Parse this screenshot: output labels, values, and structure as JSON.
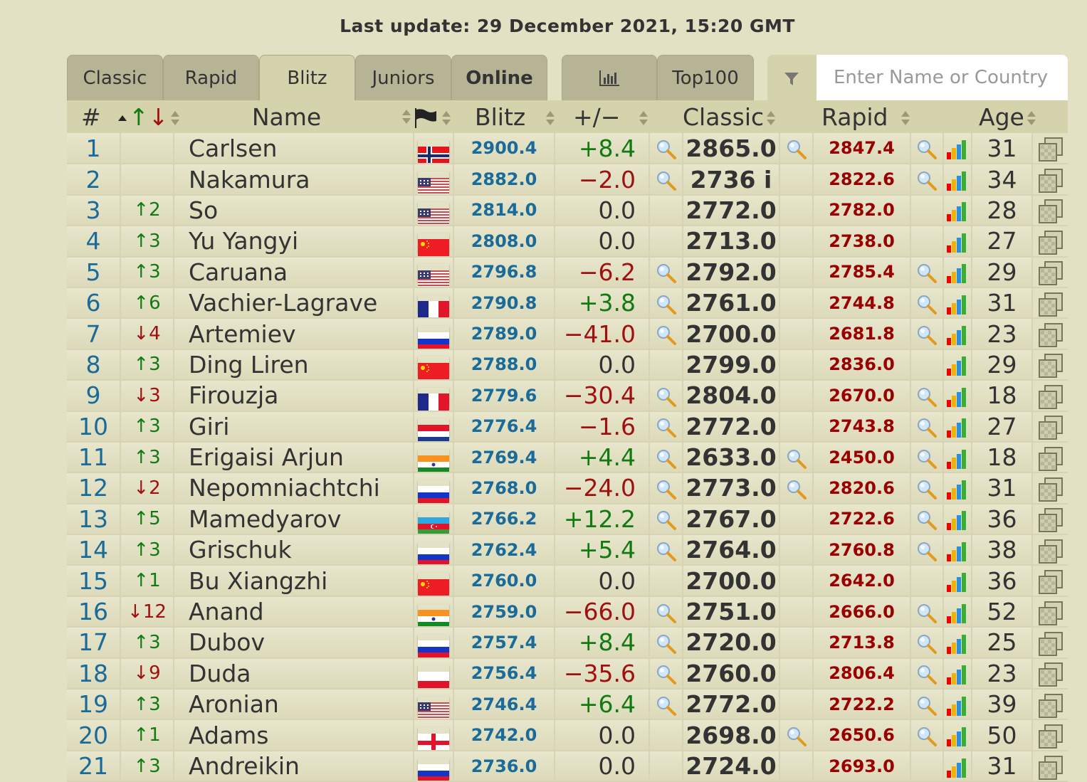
{
  "header": {
    "last_update": "Last update: 29 December 2021, 15:20 GMT"
  },
  "tabs": [
    {
      "label": "Classic",
      "active": false,
      "bold": false
    },
    {
      "label": "Rapid",
      "active": false,
      "bold": false
    },
    {
      "label": "Blitz",
      "active": true,
      "bold": false
    },
    {
      "label": "Juniors",
      "active": false,
      "bold": false
    },
    {
      "label": "Online",
      "active": false,
      "bold": true
    }
  ],
  "extra_tabs": [
    {
      "label": "",
      "icon": "bar-chart-icon"
    },
    {
      "label": "Top100"
    }
  ],
  "search": {
    "placeholder": "Enter Name or Country",
    "value": ""
  },
  "columns": {
    "rank": "#",
    "move": "↑↓",
    "name": "Name",
    "flag": "flag-icon",
    "blitz": "Blitz",
    "diff": "+/−",
    "classic": "Classic",
    "rapid": "Rapid",
    "age": "Age"
  },
  "colors": {
    "background": "#e3e1c4",
    "header_bg": "#d5d3ac",
    "tab_bg": "#b6b495",
    "rank_blue": "#1a6b9a",
    "up_green": "#137a13",
    "down_red": "#a01010",
    "rapid_red": "#9a0000"
  },
  "rows": [
    {
      "rank": "1",
      "move": "",
      "dir": "",
      "name": "Carlsen",
      "country": "NOR",
      "blitz": "2900.4",
      "diff": "+8.4",
      "diff_sign": "pos",
      "diff_mag": true,
      "classic": "2865.0",
      "classic_mag": true,
      "rapid": "2847.4",
      "rapid_mag": true,
      "age": "31"
    },
    {
      "rank": "2",
      "move": "",
      "dir": "",
      "name": "Nakamura",
      "country": "USA",
      "blitz": "2882.0",
      "diff": "−2.0",
      "diff_sign": "neg",
      "diff_mag": true,
      "classic": "2736 i",
      "classic_mag": false,
      "rapid": "2822.6",
      "rapid_mag": true,
      "age": "34"
    },
    {
      "rank": "3",
      "move": "2",
      "dir": "up",
      "name": "So",
      "country": "USA",
      "blitz": "2814.0",
      "diff": "0.0",
      "diff_sign": "zero",
      "diff_mag": false,
      "classic": "2772.0",
      "classic_mag": false,
      "rapid": "2782.0",
      "rapid_mag": false,
      "age": "28"
    },
    {
      "rank": "4",
      "move": "3",
      "dir": "up",
      "name": "Yu Yangyi",
      "country": "CHN",
      "blitz": "2808.0",
      "diff": "0.0",
      "diff_sign": "zero",
      "diff_mag": false,
      "classic": "2713.0",
      "classic_mag": false,
      "rapid": "2738.0",
      "rapid_mag": false,
      "age": "27"
    },
    {
      "rank": "5",
      "move": "3",
      "dir": "up",
      "name": "Caruana",
      "country": "USA",
      "blitz": "2796.8",
      "diff": "−6.2",
      "diff_sign": "neg",
      "diff_mag": true,
      "classic": "2792.0",
      "classic_mag": false,
      "rapid": "2785.4",
      "rapid_mag": true,
      "age": "29"
    },
    {
      "rank": "6",
      "move": "6",
      "dir": "up",
      "name": "Vachier-Lagrave",
      "country": "FRA",
      "blitz": "2790.8",
      "diff": "+3.8",
      "diff_sign": "pos",
      "diff_mag": true,
      "classic": "2761.0",
      "classic_mag": false,
      "rapid": "2744.8",
      "rapid_mag": true,
      "age": "31"
    },
    {
      "rank": "7",
      "move": "4",
      "dir": "down",
      "name": "Artemiev",
      "country": "RUS",
      "blitz": "2789.0",
      "diff": "−41.0",
      "diff_sign": "neg",
      "diff_mag": true,
      "classic": "2700.0",
      "classic_mag": false,
      "rapid": "2681.8",
      "rapid_mag": true,
      "age": "23"
    },
    {
      "rank": "8",
      "move": "3",
      "dir": "up",
      "name": "Ding Liren",
      "country": "CHN",
      "blitz": "2788.0",
      "diff": "0.0",
      "diff_sign": "zero",
      "diff_mag": false,
      "classic": "2799.0",
      "classic_mag": false,
      "rapid": "2836.0",
      "rapid_mag": false,
      "age": "29"
    },
    {
      "rank": "9",
      "move": "3",
      "dir": "down",
      "name": "Firouzja",
      "country": "FRA",
      "blitz": "2779.6",
      "diff": "−30.4",
      "diff_sign": "neg",
      "diff_mag": true,
      "classic": "2804.0",
      "classic_mag": false,
      "rapid": "2670.0",
      "rapid_mag": true,
      "age": "18"
    },
    {
      "rank": "10",
      "move": "3",
      "dir": "up",
      "name": "Giri",
      "country": "NED",
      "blitz": "2776.4",
      "diff": "−1.6",
      "diff_sign": "neg",
      "diff_mag": true,
      "classic": "2772.0",
      "classic_mag": false,
      "rapid": "2743.8",
      "rapid_mag": true,
      "age": "27"
    },
    {
      "rank": "11",
      "move": "3",
      "dir": "up",
      "name": "Erigaisi Arjun",
      "country": "IND",
      "blitz": "2769.4",
      "diff": "+4.4",
      "diff_sign": "pos",
      "diff_mag": true,
      "classic": "2633.0",
      "classic_mag": true,
      "rapid": "2450.0",
      "rapid_mag": true,
      "age": "18"
    },
    {
      "rank": "12",
      "move": "2",
      "dir": "down",
      "name": "Nepomniachtchi",
      "country": "RUS",
      "blitz": "2768.0",
      "diff": "−24.0",
      "diff_sign": "neg",
      "diff_mag": true,
      "classic": "2773.0",
      "classic_mag": true,
      "rapid": "2820.6",
      "rapid_mag": true,
      "age": "31"
    },
    {
      "rank": "13",
      "move": "5",
      "dir": "up",
      "name": "Mamedyarov",
      "country": "AZE",
      "blitz": "2766.2",
      "diff": "+12.2",
      "diff_sign": "pos",
      "diff_mag": true,
      "classic": "2767.0",
      "classic_mag": false,
      "rapid": "2722.6",
      "rapid_mag": true,
      "age": "36"
    },
    {
      "rank": "14",
      "move": "3",
      "dir": "up",
      "name": "Grischuk",
      "country": "RUS",
      "blitz": "2762.4",
      "diff": "+5.4",
      "diff_sign": "pos",
      "diff_mag": true,
      "classic": "2764.0",
      "classic_mag": false,
      "rapid": "2760.8",
      "rapid_mag": true,
      "age": "38"
    },
    {
      "rank": "15",
      "move": "1",
      "dir": "up",
      "name": "Bu Xiangzhi",
      "country": "CHN",
      "blitz": "2760.0",
      "diff": "0.0",
      "diff_sign": "zero",
      "diff_mag": false,
      "classic": "2700.0",
      "classic_mag": false,
      "rapid": "2642.0",
      "rapid_mag": false,
      "age": "36"
    },
    {
      "rank": "16",
      "move": "12",
      "dir": "down",
      "name": "Anand",
      "country": "IND",
      "blitz": "2759.0",
      "diff": "−66.0",
      "diff_sign": "neg",
      "diff_mag": true,
      "classic": "2751.0",
      "classic_mag": false,
      "rapid": "2666.0",
      "rapid_mag": true,
      "age": "52"
    },
    {
      "rank": "17",
      "move": "3",
      "dir": "up",
      "name": "Dubov",
      "country": "RUS",
      "blitz": "2757.4",
      "diff": "+8.4",
      "diff_sign": "pos",
      "diff_mag": true,
      "classic": "2720.0",
      "classic_mag": false,
      "rapid": "2713.8",
      "rapid_mag": true,
      "age": "25"
    },
    {
      "rank": "18",
      "move": "9",
      "dir": "down",
      "name": "Duda",
      "country": "POL",
      "blitz": "2756.4",
      "diff": "−35.6",
      "diff_sign": "neg",
      "diff_mag": true,
      "classic": "2760.0",
      "classic_mag": false,
      "rapid": "2806.4",
      "rapid_mag": true,
      "age": "23"
    },
    {
      "rank": "19",
      "move": "3",
      "dir": "up",
      "name": "Aronian",
      "country": "USA",
      "blitz": "2746.4",
      "diff": "+6.4",
      "diff_sign": "pos",
      "diff_mag": true,
      "classic": "2772.0",
      "classic_mag": false,
      "rapid": "2722.2",
      "rapid_mag": true,
      "age": "39"
    },
    {
      "rank": "20",
      "move": "1",
      "dir": "up",
      "name": "Adams",
      "country": "ENG",
      "blitz": "2742.0",
      "diff": "0.0",
      "diff_sign": "zero",
      "diff_mag": false,
      "classic": "2698.0",
      "classic_mag": true,
      "rapid": "2650.6",
      "rapid_mag": true,
      "age": "50"
    },
    {
      "rank": "21",
      "move": "3",
      "dir": "up",
      "name": "Andreikin",
      "country": "RUS",
      "blitz": "2736.0",
      "diff": "0.0",
      "diff_sign": "zero",
      "diff_mag": false,
      "classic": "2724.0",
      "classic_mag": false,
      "rapid": "2693.0",
      "rapid_mag": false,
      "age": "31"
    }
  ]
}
